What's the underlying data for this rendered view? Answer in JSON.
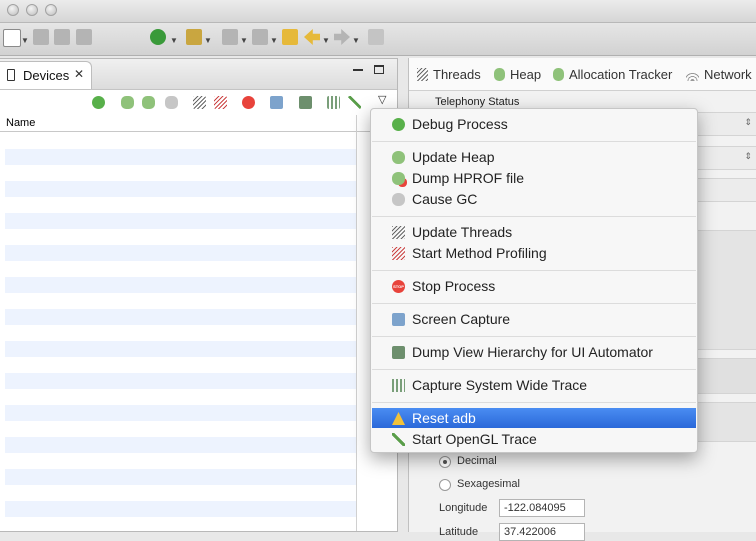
{
  "devices_panel": {
    "tab_label": "Devices",
    "name_column": "Name"
  },
  "right_panel": {
    "tabs": [
      {
        "label": "Threads",
        "icon": "threads-icon"
      },
      {
        "label": "Heap",
        "icon": "heap-icon"
      },
      {
        "label": "Allocation Tracker",
        "icon": "allocation-tracker-icon"
      },
      {
        "label": "Network",
        "icon": "network-icon"
      }
    ],
    "telephony_status": "Telephony Status",
    "location": {
      "decimal_label": "Decimal",
      "sexagesimal_label": "Sexagesimal",
      "longitude_label": "Longitude",
      "longitude_value": "-122.084095",
      "latitude_label": "Latitude",
      "latitude_value": "37.422006"
    }
  },
  "context_menu": {
    "items": [
      {
        "label": "Debug Process",
        "icon": "bug-icon"
      },
      {
        "label": "Update Heap",
        "icon": "heap-icon"
      },
      {
        "label": "Dump HPROF file",
        "icon": "dump-hprof-icon"
      },
      {
        "label": "Cause GC",
        "icon": "gc-icon"
      },
      {
        "label": "Update Threads",
        "icon": "threads-icon"
      },
      {
        "label": "Start Method Profiling",
        "icon": "profiling-icon"
      },
      {
        "label": "Stop Process",
        "icon": "stop-icon",
        "icon_text": "STOP"
      },
      {
        "label": "Screen Capture",
        "icon": "camera-icon"
      },
      {
        "label": "Dump View Hierarchy for UI Automator",
        "icon": "view-hierarchy-icon"
      },
      {
        "label": "Capture System Wide Trace",
        "icon": "systrace-icon"
      },
      {
        "label": "Reset adb",
        "icon": "warning-icon"
      },
      {
        "label": "Start OpenGL Trace",
        "icon": "opengl-trace-icon"
      }
    ],
    "selected": "Reset adb"
  },
  "colors": {
    "selection": "#2f6fdf",
    "stop": "#e8433b",
    "heap_green": "#6aa84f",
    "row_stripe": "#edf3fe"
  }
}
